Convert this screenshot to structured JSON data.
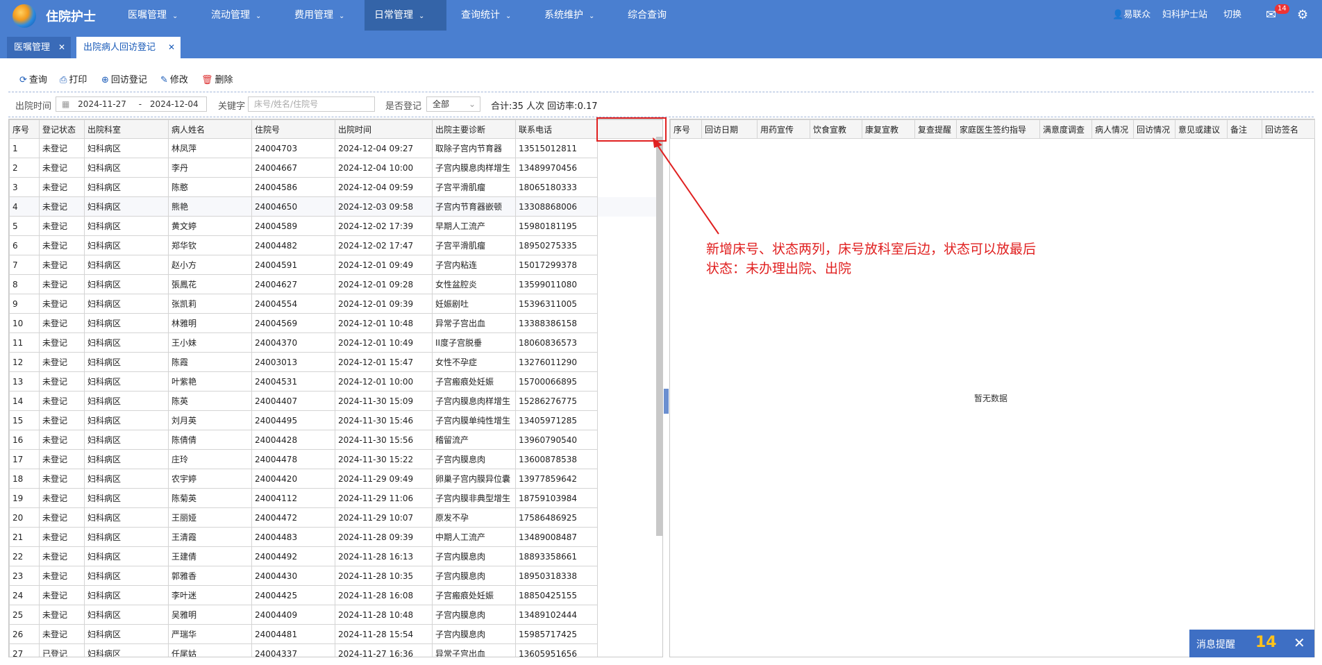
{
  "app": {
    "title": "住院护士"
  },
  "nav": {
    "menus": [
      {
        "label": "医嘱管理"
      },
      {
        "label": "流动管理"
      },
      {
        "label": "费用管理"
      },
      {
        "label": "日常管理"
      },
      {
        "label": "查询统计"
      },
      {
        "label": "系统维护"
      },
      {
        "label": "综合查询"
      }
    ],
    "active_index": 3,
    "user": "易联众",
    "station": "妇科护士站",
    "switch_label": "切换",
    "mail_badge": "14",
    "icons": [
      "logo",
      "chevron-down-icon",
      "user-icon",
      "mail-icon",
      "gear-icon",
      "grid-icon"
    ]
  },
  "tabs": [
    {
      "label": "医嘱管理"
    },
    {
      "label": "出院病人回访登记"
    }
  ],
  "toolbar": {
    "query": "查询",
    "print": "打印",
    "revisit": "回访登记",
    "edit": "修改",
    "delete": "删除"
  },
  "filter": {
    "date_label": "出院时间",
    "date_from": "2024-11-27",
    "date_sep": "-",
    "date_to": "2024-12-04",
    "keyword_label": "关键字",
    "keyword_placeholder": "床号/姓名/住院号",
    "registered_label": "是否登记",
    "registered_value": "全部",
    "summary": "合计:35 人次  回访率:0.17"
  },
  "left_table": {
    "columns": [
      "序号",
      "登记状态",
      "出院科室",
      "病人姓名",
      "住院号",
      "出院时间",
      "出院主要诊断",
      "联系电话",
      ""
    ],
    "rows": [
      [
        "1",
        "未登记",
        "妇科病区",
        "林凤萍",
        "24004703",
        "2024-12-04 09:27",
        "取除子宫内节育器",
        "13515012811"
      ],
      [
        "2",
        "未登记",
        "妇科病区",
        "李丹",
        "24004667",
        "2024-12-04 10:00",
        "子宫内膜息肉样增生",
        "13489970456"
      ],
      [
        "3",
        "未登记",
        "妇科病区",
        "陈憨",
        "24004586",
        "2024-12-04 09:59",
        "子宫平滑肌瘤",
        "18065180333"
      ],
      [
        "4",
        "未登记",
        "妇科病区",
        "熊艳",
        "24004650",
        "2024-12-03 09:58",
        "子宫内节育器嵌顿",
        "13308868006"
      ],
      [
        "5",
        "未登记",
        "妇科病区",
        "黄文婷",
        "24004589",
        "2024-12-02 17:39",
        "早期人工流产",
        "15980181195"
      ],
      [
        "6",
        "未登记",
        "妇科病区",
        "郑华钦",
        "24004482",
        "2024-12-02 17:47",
        "子宫平滑肌瘤",
        "18950275335"
      ],
      [
        "7",
        "未登记",
        "妇科病区",
        "赵小方",
        "24004591",
        "2024-12-01 09:49",
        "子宫内粘连",
        "15017299378"
      ],
      [
        "8",
        "未登记",
        "妇科病区",
        "張鳳花",
        "24004627",
        "2024-12-01 09:28",
        "女性盆腔炎",
        "13599011080"
      ],
      [
        "9",
        "未登记",
        "妇科病区",
        "张凯莉",
        "24004554",
        "2024-12-01 09:39",
        "妊娠剧吐",
        "15396311005"
      ],
      [
        "10",
        "未登记",
        "妇科病区",
        "林雅明",
        "24004569",
        "2024-12-01 10:48",
        "异常子宫出血",
        "13388386158"
      ],
      [
        "11",
        "未登记",
        "妇科病区",
        "王小妹",
        "24004370",
        "2024-12-01 10:49",
        "II度子宫脱垂",
        "18060836573"
      ],
      [
        "12",
        "未登记",
        "妇科病区",
        "陈霞",
        "24003013",
        "2024-12-01 15:47",
        "女性不孕症",
        "13276011290"
      ],
      [
        "13",
        "未登记",
        "妇科病区",
        "叶紫艳",
        "24004531",
        "2024-12-01 10:00",
        "子宫瘢痕处妊娠",
        "15700066895"
      ],
      [
        "14",
        "未登记",
        "妇科病区",
        "陈英",
        "24004407",
        "2024-11-30 15:09",
        "子宫内膜息肉样增生",
        "15286276775"
      ],
      [
        "15",
        "未登记",
        "妇科病区",
        "刘月英",
        "24004495",
        "2024-11-30 15:46",
        "子宫内膜单纯性增生",
        "13405971285"
      ],
      [
        "16",
        "未登记",
        "妇科病区",
        "陈倩倩",
        "24004428",
        "2024-11-30 15:56",
        "稽留流产",
        "13960790540"
      ],
      [
        "17",
        "未登记",
        "妇科病区",
        "庄玲",
        "24004478",
        "2024-11-30 15:22",
        "子宫内膜息肉",
        "13600878538"
      ],
      [
        "18",
        "未登记",
        "妇科病区",
        "农宇婷",
        "24004420",
        "2024-11-29 09:49",
        "卵巢子宫内膜异位囊",
        "13977859642"
      ],
      [
        "19",
        "未登记",
        "妇科病区",
        "陈菊英",
        "24004112",
        "2024-11-29 11:06",
        "子宫内膜非典型增生",
        "18759103984"
      ],
      [
        "20",
        "未登记",
        "妇科病区",
        "王丽娅",
        "24004472",
        "2024-11-29 10:07",
        "原发不孕",
        "17586486925"
      ],
      [
        "21",
        "未登记",
        "妇科病区",
        "王清霞",
        "24004483",
        "2024-11-28 09:39",
        "中期人工流产",
        "13489008487"
      ],
      [
        "22",
        "未登记",
        "妇科病区",
        "王建倩",
        "24004492",
        "2024-11-28 16:13",
        "子宫内膜息肉",
        "18893358661"
      ],
      [
        "23",
        "未登记",
        "妇科病区",
        "郭雅香",
        "24004430",
        "2024-11-28 10:35",
        "子宫内膜息肉",
        "18950318338"
      ],
      [
        "24",
        "未登记",
        "妇科病区",
        "李叶迷",
        "24004425",
        "2024-11-28 16:08",
        "子宫瘢痕处妊娠",
        "18850425155"
      ],
      [
        "25",
        "未登记",
        "妇科病区",
        "吴雅明",
        "24004409",
        "2024-11-28 10:48",
        "子宫内膜息肉",
        "13489102444"
      ],
      [
        "26",
        "未登记",
        "妇科病区",
        "严瑞华",
        "24004481",
        "2024-11-28 15:54",
        "子宫内膜息肉",
        "15985717425"
      ],
      [
        "27",
        "已登记",
        "妇科病区",
        "任尾姑",
        "24004337",
        "2024-11-27 16:36",
        "异常子宫出血",
        "13605951656"
      ]
    ]
  },
  "right_table": {
    "columns": [
      "序号",
      "回访日期",
      "用药宣传",
      "饮食宣教",
      "康复宣教",
      "复查提醒",
      "家庭医生签约指导",
      "满意度调查",
      "病人情况",
      "回访情况",
      "意见或建议",
      "备注",
      "回访签名"
    ],
    "empty_text": "暂无数据"
  },
  "annotation": {
    "line1": "新增床号、状态两列，床号放科室后边，状态可以放最后",
    "line2": "状态：未办理出院、出院",
    "color": "#e02020"
  },
  "message": {
    "label": "消息提醒",
    "count": "14"
  }
}
